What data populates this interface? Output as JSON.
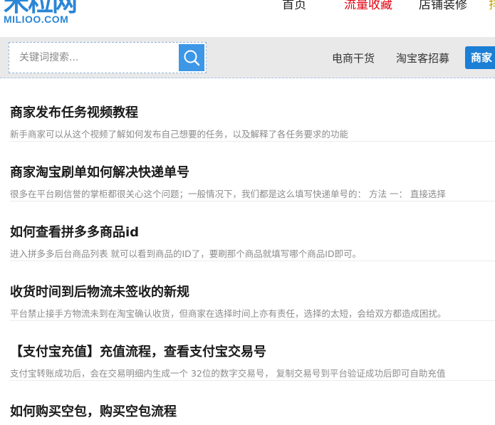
{
  "header": {
    "logo_mark": "米粒网",
    "logo_sub": "MILIOO.COM",
    "nav": [
      {
        "label": "首页",
        "active": false
      },
      {
        "label": "流量收藏",
        "active": true
      },
      {
        "label": "店铺装修",
        "active": false
      },
      {
        "label": "排",
        "active": false
      }
    ]
  },
  "search": {
    "placeholder": "关键词搜索...",
    "value": ""
  },
  "sub_nav": [
    {
      "label": "电商干货"
    },
    {
      "label": "淘宝客招募"
    },
    {
      "label": "商家"
    }
  ],
  "articles": [
    {
      "title": "商家发布任务视频教程",
      "desc": "新手商家可以从这个视频了解如何发布自己想要的任务，以及解释了各任务要求的功能"
    },
    {
      "title": "商家淘宝刷单如何解决快递单号",
      "desc": "很多在平台刷信誉的掌柜都很关心这个问题；一般情况下，我们都是这么填写快递单号的： 方法 一：  直接选择"
    },
    {
      "title": "如何查看拼多多商品id",
      "desc": "进入拼多多后台商品列表 就可以看到商品的ID了，要刷那个商品就填写哪个商品ID即可。"
    },
    {
      "title": "收货时间到后物流未签收的新规",
      "desc": "平台禁止接手方物流未到在淘宝确认收货，但商家在选择时间上亦有责任，选择的太短，会给双方都造成困扰。"
    },
    {
      "title": "【支付宝充值】充值流程，查看支付宝交易号",
      "desc": "支付宝转账成功后，会在交易明细内生成一个 32位的数字交易号， 复制交易号到平台验证成功后即可自助充值"
    },
    {
      "title": "如何购买空包，购买空包流程",
      "desc": ""
    }
  ],
  "colors": {
    "brand": "#2a86d6",
    "active_nav": "#e4000f",
    "search_button": "#3d97e6",
    "sub_nav_active": "#1b7fd6"
  },
  "icons": {
    "search_button": "search-icon"
  }
}
